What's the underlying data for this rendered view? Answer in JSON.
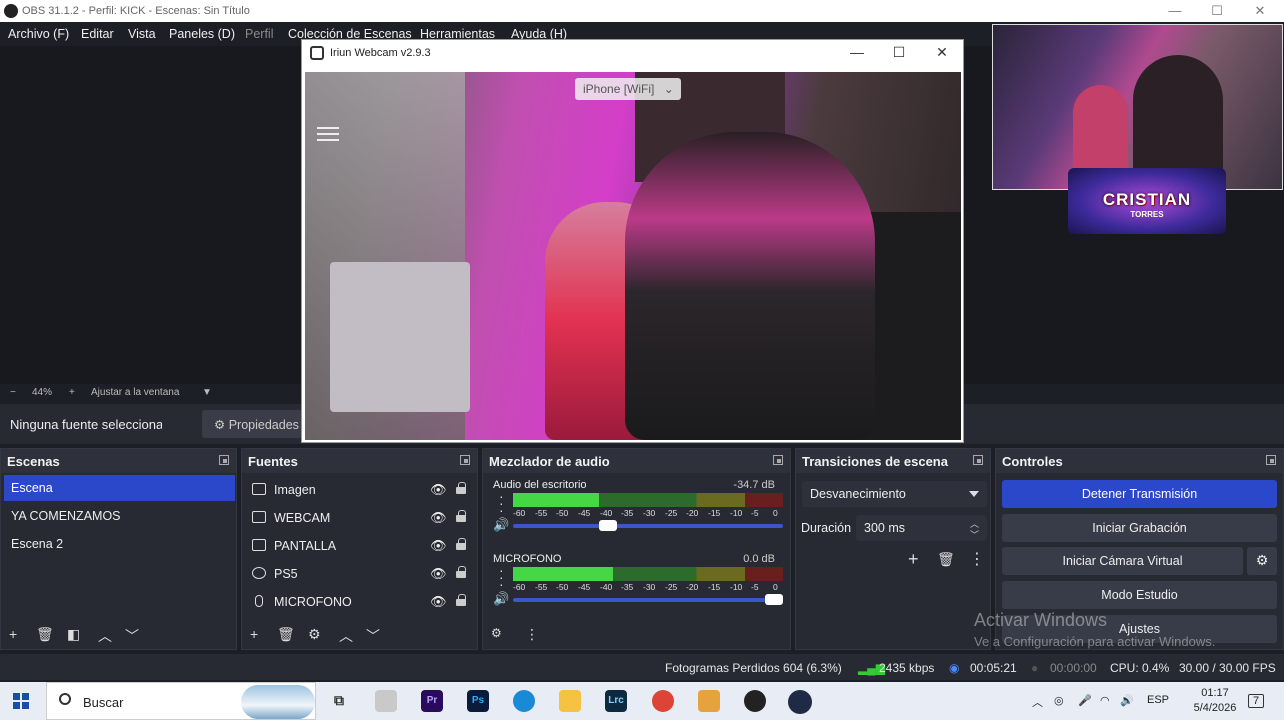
{
  "window": {
    "title": "OBS 31.1.2 - Perfil: KICK - Escenas: Sin Título",
    "minimize": "—",
    "maximize": "☐",
    "close": "✕"
  },
  "menu": {
    "items": [
      "Archivo (F)",
      "Editar",
      "Vista",
      "Paneles (D)",
      "Perfil",
      "Colección de Escenas",
      "Herramientas",
      "Ayuda (H)"
    ]
  },
  "zoom": {
    "minus": "−",
    "value": "44%",
    "plus": "+",
    "fit_label": "Ajustar a la ventana",
    "caret": "▼"
  },
  "context": {
    "no_selection": "Ninguna fuente seleccionada",
    "properties": "Propiedades",
    "properties_icon": "gear-icon"
  },
  "iriun": {
    "title": "Iriun Webcam v2.9.3",
    "device": "iPhone [WiFi]",
    "device_caret": "⌄",
    "minimize": "—",
    "maximize": "☐",
    "close": "✕"
  },
  "logo": {
    "text": "CRISTIAN",
    "sub": "TORRES"
  },
  "scenes": {
    "title": "Escenas",
    "items": [
      "Escena",
      "YA COMENZAMOS",
      "Escena 2"
    ],
    "selected": 0
  },
  "sources": {
    "title": "Fuentes",
    "items": [
      {
        "label": "Imagen",
        "icon": "image-icon"
      },
      {
        "label": "WEBCAM",
        "icon": "window-icon"
      },
      {
        "label": "PANTALLA",
        "icon": "monitor-icon"
      },
      {
        "label": "PS5",
        "icon": "gamepad-icon"
      },
      {
        "label": "MICROFONO",
        "icon": "microphone-icon"
      }
    ]
  },
  "mixer": {
    "title": "Mezclador de audio",
    "channels": [
      {
        "name": "Audio del escritorio",
        "db": "-34.7 dB",
        "level": 0.32,
        "volume": 0.34
      },
      {
        "name": "MICROFONO",
        "db": "0.0 dB",
        "level": 0.37,
        "volume": 1.0
      }
    ],
    "ticks": [
      "-60",
      "-55",
      "-50",
      "-45",
      "-40",
      "-35",
      "-30",
      "-25",
      "-20",
      "-15",
      "-10",
      "-5",
      "0"
    ]
  },
  "transitions": {
    "title": "Transiciones de escena",
    "selected": "Desvanecimiento",
    "duration_label": "Duración",
    "duration": "300 ms"
  },
  "controls": {
    "title": "Controles",
    "buttons": [
      "Detener Transmisión",
      "Iniciar Grabación",
      "Iniciar Cámara Virtual",
      "Modo Estudio",
      "Ajustes"
    ]
  },
  "status": {
    "dropped": "Fotogramas Perdidos 604 (6.3%)",
    "bitrate": "2435 kbps",
    "stream_time": "00:05:21",
    "rec_time": "00:00:00",
    "cpu": "CPU: 0.4%",
    "fps": "30.00 / 30.00 FPS"
  },
  "watermark": {
    "line1": "Activar Windows",
    "line2": "Ve a Configuración para activar Windows."
  },
  "taskbar": {
    "search": "Buscar",
    "lang": "ESP",
    "time": "01:17",
    "date": "5/4/2026",
    "notif": "7"
  },
  "colors": {
    "accent": "#2a48c9",
    "panel": "#272a33",
    "bg": "#1d1f26"
  }
}
